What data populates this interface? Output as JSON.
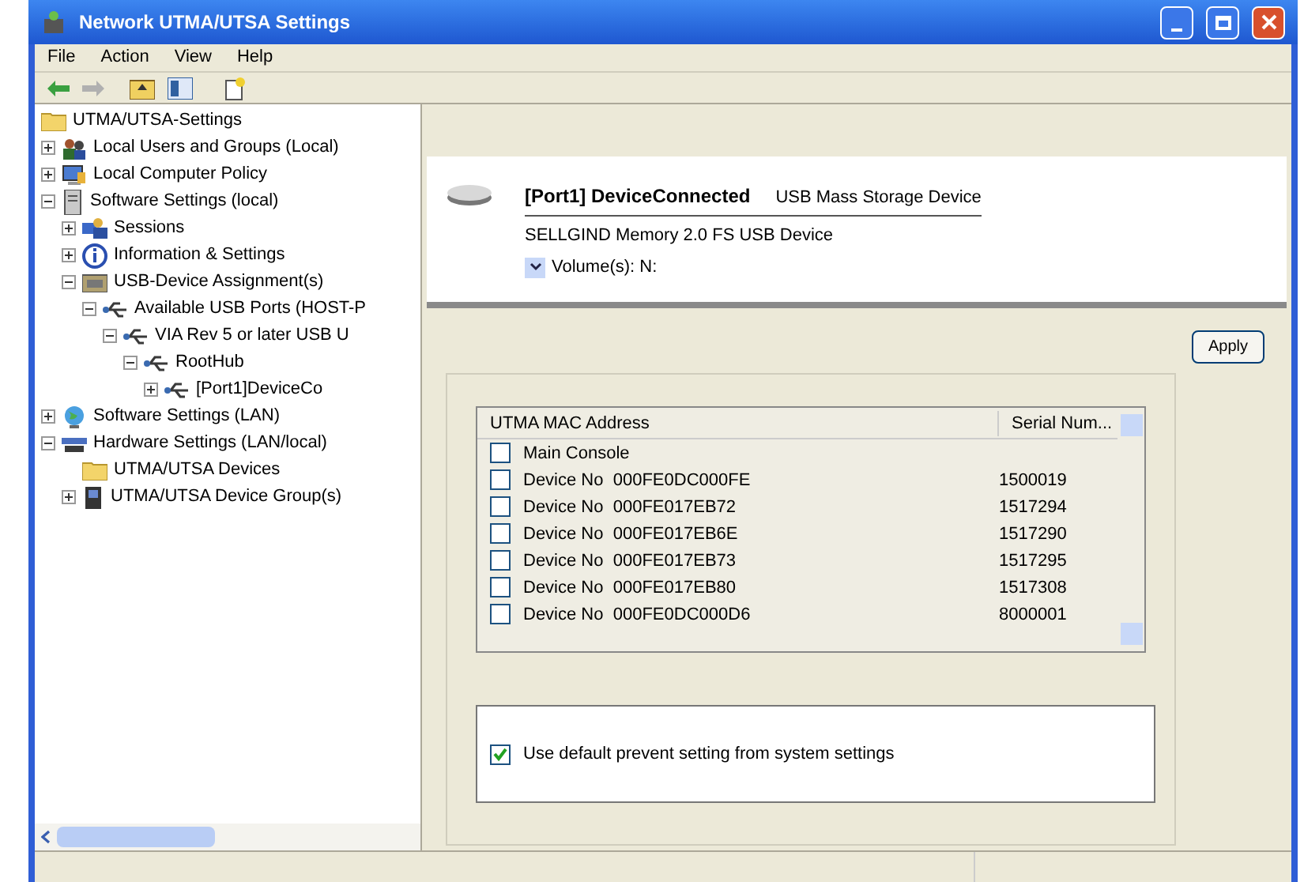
{
  "window": {
    "title": "Network UTMA/UTSA Settings"
  },
  "menu": [
    "File",
    "Action",
    "View",
    "Help"
  ],
  "tree": [
    {
      "label": "UTMA/UTSA-Settings",
      "kind": "folder",
      "children": [
        {
          "label": "Local Users and Groups (Local)",
          "kind": "users",
          "expanded": false
        },
        {
          "label": "Local Computer Policy",
          "kind": "policy",
          "expanded": false
        },
        {
          "label": "Software Settings (local)",
          "kind": "server",
          "expanded": true,
          "children": [
            {
              "label": "Sessions",
              "kind": "sessions",
              "expanded": false
            },
            {
              "label": "Information & Settings",
              "kind": "info",
              "expanded": false
            },
            {
              "label": "USB-Device Assignment(s)",
              "kind": "drawer",
              "expanded": true,
              "children": [
                {
                  "label": "Available USB Ports (HOST-P",
                  "kind": "usb",
                  "expanded": true,
                  "children": [
                    {
                      "label": "VIA Rev 5 or later USB U",
                      "kind": "usb",
                      "expanded": true,
                      "children": [
                        {
                          "label": "RootHub",
                          "kind": "usb",
                          "expanded": true,
                          "children": [
                            {
                              "label": "[Port1]DeviceCo",
                              "kind": "usb",
                              "expanded": false
                            }
                          ]
                        }
                      ]
                    }
                  ]
                }
              ]
            }
          ]
        },
        {
          "label": "Software Settings (LAN)",
          "kind": "globe",
          "expanded": false
        },
        {
          "label": "Hardware Settings (LAN/local)",
          "kind": "hardware",
          "expanded": true,
          "children": [
            {
              "label": "UTMA/UTSA Devices",
              "kind": "folder"
            },
            {
              "label": "UTMA/UTSA Device Group(s)",
              "kind": "device",
              "expanded": false
            }
          ]
        }
      ]
    }
  ],
  "device": {
    "title": "[Port1] DeviceConnected",
    "type": "USB Mass Storage Device",
    "name": "SELLGIND Memory 2.0 FS USB Device",
    "volumes": "Volume(s): N:"
  },
  "apply_button": "Apply",
  "table": {
    "columns": [
      "UTMA MAC Address",
      "Serial Num..."
    ],
    "rows": [
      {
        "address": "Main Console",
        "serial": "",
        "checked": false
      },
      {
        "address": "Device No  000FE0DC000FE",
        "serial": "1500019",
        "checked": false
      },
      {
        "address": "Device No  000FE017EB72",
        "serial": "1517294",
        "checked": false
      },
      {
        "address": "Device No  000FE017EB6E",
        "serial": "1517290",
        "checked": false
      },
      {
        "address": "Device No  000FE017EB73",
        "serial": "1517295",
        "checked": false
      },
      {
        "address": "Device No  000FE017EB80",
        "serial": "1517308",
        "checked": false
      },
      {
        "address": "Device No  000FE0DC000D6",
        "serial": "8000001",
        "checked": false
      }
    ]
  },
  "default_setting": {
    "label": "Use default prevent setting from system settings",
    "checked": true
  }
}
